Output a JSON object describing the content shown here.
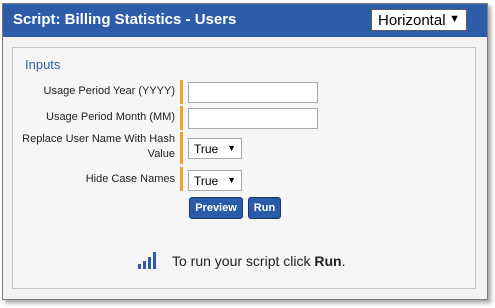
{
  "window": {
    "title": "Script: Billing Statistics - Users",
    "orientation": {
      "selected": "Horizontal"
    }
  },
  "inputs": {
    "heading": "Inputs",
    "fields": [
      {
        "label": "Usage Period Year (YYYY)",
        "value": ""
      },
      {
        "label": "Usage Period Month (MM)",
        "value": ""
      },
      {
        "label": "Replace User Name With Hash Value",
        "selected": "True"
      },
      {
        "label": "Hide Case Names",
        "selected": "True"
      }
    ],
    "preview_label": "Preview",
    "run_label": "Run"
  },
  "hint": {
    "text": "To run your script click",
    "bold": "Run",
    "suffix": "."
  }
}
